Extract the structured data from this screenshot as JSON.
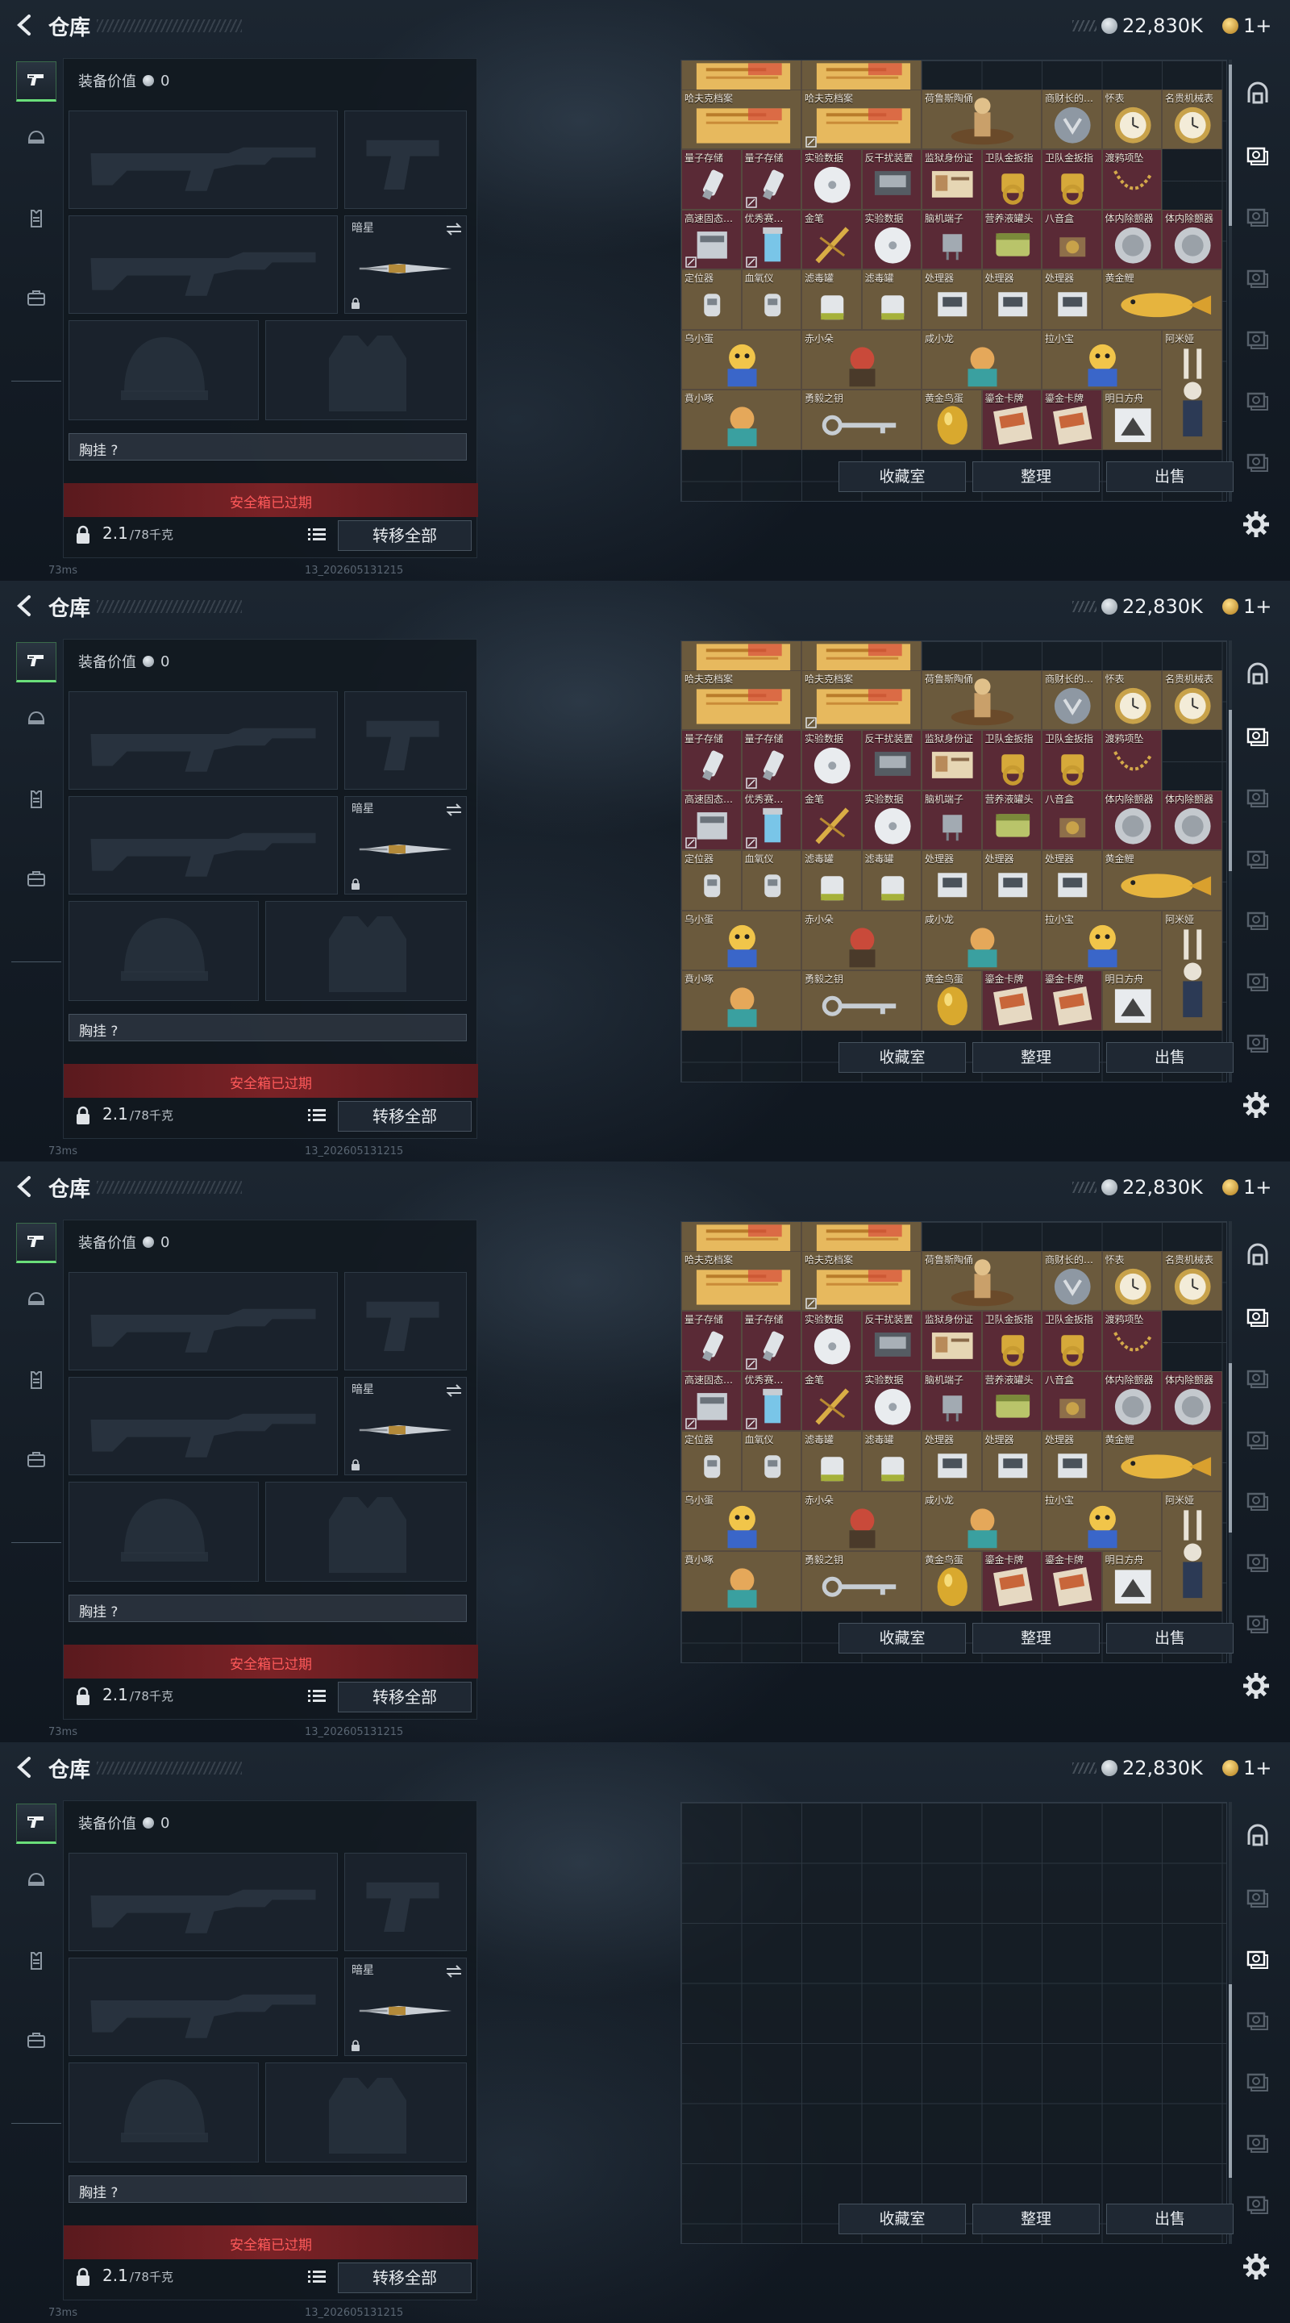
{
  "header": {
    "title": "仓库",
    "silver": "22,830K",
    "gold": "1+"
  },
  "loadout": {
    "value_label": "装备价值",
    "value": "0",
    "melee_label": "暗星",
    "chest_rig_label": "胸挂 ?",
    "safe_box_status": "安全箱已过期",
    "weight": "2.1",
    "weight_max": "/78千克",
    "transfer_all": "转移全部"
  },
  "footer": {
    "ping": "73ms",
    "build": "13_202605131215"
  },
  "actions": {
    "collection": "收藏室",
    "organize": "整理",
    "sell": "出售"
  },
  "colors": {
    "accent_green": "#6adf7a",
    "warning_red": "#ff5a5a",
    "rare_bg": "#6b5a3d",
    "epic_bg": "#5a2a36"
  },
  "icons": [
    "back-arrow-icon",
    "pistol-icon",
    "helmet-icon",
    "backpack-icon",
    "briefcase-icon",
    "silver-coin-icon",
    "gold-coin-icon",
    "lock-icon",
    "list-icon",
    "swap-icon",
    "settings-gear-icon",
    "safe-icon",
    "container-icon"
  ],
  "stash": {
    "items": [
      "哈夫克档案",
      "哈夫克档案",
      "哈夫克档案",
      "哈夫克档案",
      "荷鲁斯陶俑",
      "商财长的…",
      "怀表",
      "名贵机械表",
      "量子存储",
      "量子存储",
      "实验数据",
      "反干扰装置",
      "监狱身份证",
      "卫队金扳指",
      "卫队金扳指",
      "渡鸦项坠",
      "高速固态…",
      "优秀赛…",
      "金笔",
      "实验数据",
      "脑机端子",
      "营养液罐头",
      "八音盒",
      "体内除颤器",
      "体内除颤器",
      "定位器",
      "血氧仪",
      "滤毒罐",
      "滤毒罐",
      "处理器",
      "处理器",
      "处理器",
      "黄金鲤",
      "乌小蛋",
      "赤小朵",
      "咸小龙",
      "拉小宝",
      "阿米娅",
      "賁小啄",
      "勇毅之钥",
      "黄金鸟蛋",
      "鎏金卡牌",
      "鎏金卡牌",
      "明日方舟"
    ]
  }
}
